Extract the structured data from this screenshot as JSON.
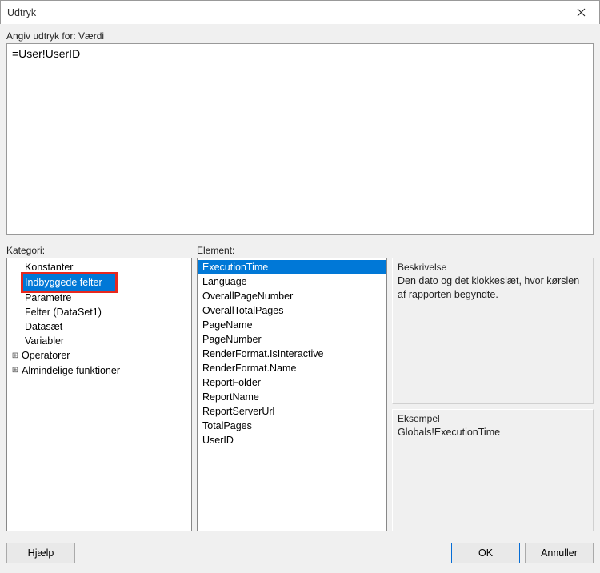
{
  "title": "Udtryk",
  "expression_label": "Angiv udtryk for: Værdi",
  "expression_value": "=User!UserID",
  "category_label": "Kategori:",
  "element_label": "Element:",
  "categories": {
    "items": [
      {
        "label": "Konstanter",
        "expandable": false,
        "selected": false
      },
      {
        "label": "Indbyggede felter",
        "expandable": false,
        "selected": true,
        "highlighted": true
      },
      {
        "label": "Parametre",
        "expandable": false,
        "selected": false
      },
      {
        "label": "Felter (DataSet1)",
        "expandable": false,
        "selected": false
      },
      {
        "label": "Datasæt",
        "expandable": false,
        "selected": false
      },
      {
        "label": "Variabler",
        "expandable": false,
        "selected": false
      },
      {
        "label": "Operatorer",
        "expandable": true,
        "selected": false
      },
      {
        "label": "Almindelige funktioner",
        "expandable": true,
        "selected": false
      }
    ]
  },
  "elements": {
    "items": [
      {
        "label": "ExecutionTime",
        "selected": true
      },
      {
        "label": "Language"
      },
      {
        "label": "OverallPageNumber"
      },
      {
        "label": "OverallTotalPages"
      },
      {
        "label": "PageName"
      },
      {
        "label": "PageNumber"
      },
      {
        "label": "RenderFormat.IsInteractive"
      },
      {
        "label": "RenderFormat.Name"
      },
      {
        "label": "ReportFolder"
      },
      {
        "label": "ReportName"
      },
      {
        "label": "ReportServerUrl"
      },
      {
        "label": "TotalPages"
      },
      {
        "label": "UserID"
      }
    ]
  },
  "description": {
    "title": "Beskrivelse",
    "text": "Den dato og det klokkeslæt, hvor kørslen af rapporten begyndte."
  },
  "example": {
    "title": "Eksempel",
    "text": "Globals!ExecutionTime"
  },
  "buttons": {
    "help": "Hjælp",
    "ok": "OK",
    "cancel": "Annuller"
  }
}
